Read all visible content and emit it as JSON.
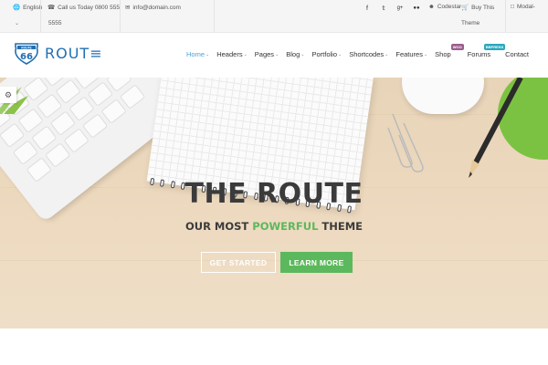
{
  "topbar": {
    "language": "English",
    "call_label": "Call us Today 0800 555",
    "call_label_2": "5555",
    "email": "info@domain.com",
    "social": [
      "facebook-icon",
      "twitter-icon",
      "google-plus-icon",
      "flickr-icon"
    ],
    "codestar": "Codestar",
    "buy_line_1": "Buy This",
    "buy_line_2": "Theme",
    "modal": "Modal-"
  },
  "header": {
    "logo_badge_top": "ROUTE",
    "logo_badge_num": "66",
    "logo_text": "ROUT≡",
    "nav": [
      {
        "label": "Home",
        "caret": true,
        "active": true
      },
      {
        "label": "Headers",
        "caret": true
      },
      {
        "label": "Pages",
        "caret": true
      },
      {
        "label": "Blog",
        "caret": true
      },
      {
        "label": "Portfolio",
        "caret": true
      },
      {
        "label": "Shortcodes",
        "caret": true
      },
      {
        "label": "Features",
        "caret": true
      },
      {
        "label": "Shop",
        "badge": "WOO"
      },
      {
        "label": "Forums",
        "badge": "BBPRESS"
      },
      {
        "label": "Contact"
      }
    ]
  },
  "hero": {
    "title": "THE ROUTE",
    "sub_before": "OUR MOST ",
    "sub_accent": "POWERFUL",
    "sub_after": " THEME",
    "btn_outline": "GET STARTED",
    "btn_primary": "LEARN MORE"
  },
  "colors": {
    "accent_green": "#5cb85c",
    "active_blue": "#4a9fd8",
    "logo_blue": "#1f6fb3"
  }
}
